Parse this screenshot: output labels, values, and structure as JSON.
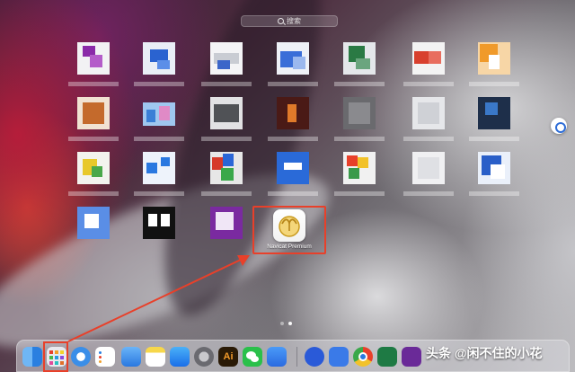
{
  "launchpad": {
    "search": {
      "placeholder": "搜索"
    },
    "highlighted_app": {
      "name": "Navicat Premium",
      "icon": "navicat-seagull-icon"
    },
    "pages": {
      "count": 2,
      "current": 2
    }
  },
  "watermark": {
    "text": "头条 @闲不住的小花"
  },
  "colors": {
    "annotation": "#e8402a"
  }
}
